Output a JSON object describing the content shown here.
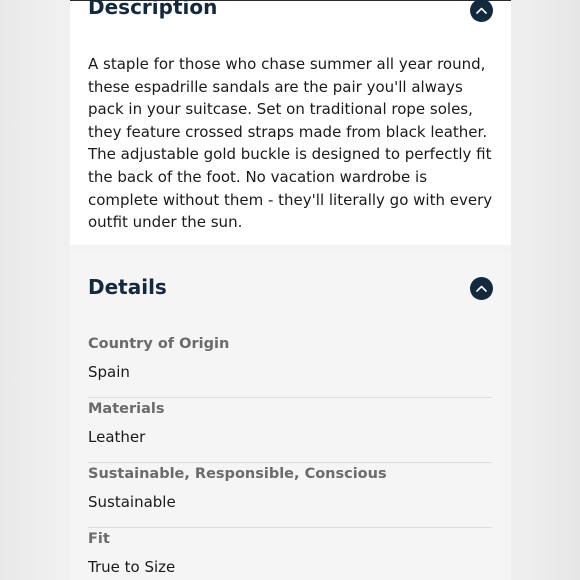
{
  "description": {
    "heading": "Description",
    "text": "A staple for those who chase summer all year round, these espadrille sandals are the pair you'll always pack in your suitcase. Set on traditional rope soles, they feature crossed straps made from black leather. The adjustable gold buckle is designed to perfectly fit the back of the foot. No vacation wardrobe is complete without them - they'll literally go with every outfit under the sun.",
    "toggle_icon": "chevron-up-icon"
  },
  "details": {
    "heading": "Details",
    "toggle_icon": "chevron-up-icon",
    "items": [
      {
        "label": "Country of Origin",
        "value": "Spain"
      },
      {
        "label": "Materials",
        "value": "Leather"
      },
      {
        "label": "Sustainable, Responsible, Conscious",
        "value": "Sustainable"
      },
      {
        "label": "Fit",
        "value": "True to Size"
      }
    ]
  },
  "colors": {
    "heading": "#13293d",
    "toggle_bg": "#13293d",
    "label": "#6b6b6b",
    "text": "#1a1a1a"
  }
}
